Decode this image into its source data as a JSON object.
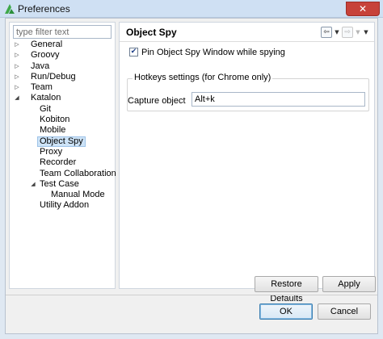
{
  "window": {
    "title": "Preferences",
    "close_glyph": "✕"
  },
  "filter": {
    "placeholder": "type filter text",
    "value": ""
  },
  "tree": [
    {
      "label": "General",
      "expander": "collapsed",
      "level": 0
    },
    {
      "label": "Groovy",
      "expander": "collapsed",
      "level": 0
    },
    {
      "label": "Java",
      "expander": "collapsed",
      "level": 0
    },
    {
      "label": "Run/Debug",
      "expander": "collapsed",
      "level": 0
    },
    {
      "label": "Team",
      "expander": "collapsed",
      "level": 0
    },
    {
      "label": "Katalon",
      "expander": "expanded",
      "level": 0
    },
    {
      "label": "Git",
      "expander": "none",
      "level": 1
    },
    {
      "label": "Kobiton",
      "expander": "none",
      "level": 1
    },
    {
      "label": "Mobile",
      "expander": "none",
      "level": 1
    },
    {
      "label": "Object Spy",
      "expander": "none",
      "level": 1,
      "selected": true
    },
    {
      "label": "Proxy",
      "expander": "none",
      "level": 1
    },
    {
      "label": "Recorder",
      "expander": "none",
      "level": 1
    },
    {
      "label": "Team Collaboration",
      "expander": "none",
      "level": 1
    },
    {
      "label": "Test Case",
      "expander": "expanded",
      "level": 1
    },
    {
      "label": "Manual Mode",
      "expander": "none",
      "level": 2
    },
    {
      "label": "Utility Addon",
      "expander": "none",
      "level": 1
    }
  ],
  "page": {
    "title": "Object Spy",
    "pin_checkbox": {
      "label": "Pin Object Spy Window while spying",
      "checked": true,
      "check_glyph": "✔"
    },
    "hotkeys_group_title": "Hotkeys settings (for Chrome only)",
    "capture_label": "Capture object",
    "capture_value": "Alt+k"
  },
  "nav": {
    "back_glyph": "⇦",
    "forward_glyph": "⇨",
    "drop_glyph": "▼",
    "menu_glyph": "▼"
  },
  "buttons": {
    "restore_defaults": "Restore Defaults",
    "apply": "Apply",
    "ok": "OK",
    "cancel": "Cancel"
  },
  "colors": {
    "selection": "#cde3f7",
    "titlebar": "#cfe0f3",
    "close": "#c7423a",
    "app_icon_green": "#3ea84a"
  }
}
